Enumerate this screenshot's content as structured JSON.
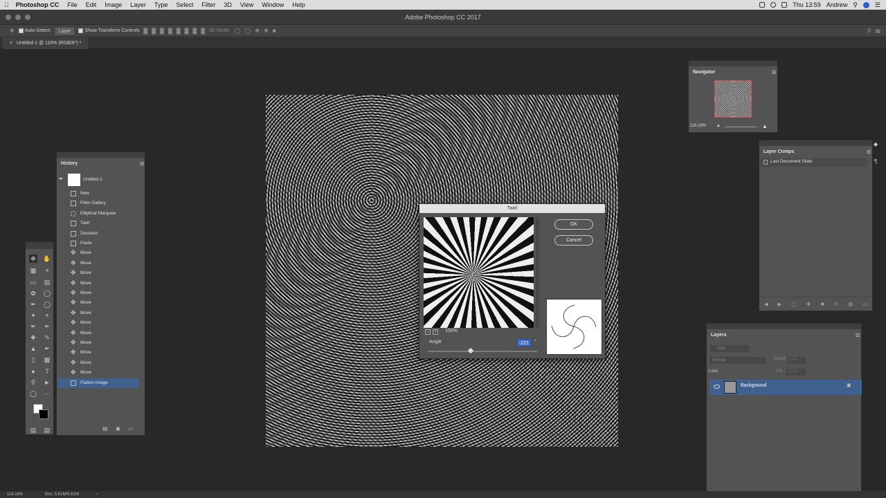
{
  "menubar": {
    "app": "Photoshop CC",
    "items": [
      "File",
      "Edit",
      "Image",
      "Layer",
      "Type",
      "Select",
      "Filter",
      "3D",
      "View",
      "Window",
      "Help"
    ],
    "clock": "Thu 13:59",
    "user": "Andrew"
  },
  "window": {
    "title": "Adobe Photoshop CC 2017"
  },
  "options": {
    "auto_select_label": "Auto-Select:",
    "auto_select_value": "Layer",
    "show_transform_label": "Show Transform Controls",
    "mode_3d_label": "3D Mode:"
  },
  "document_tab": {
    "label": "Untitled-1 @ 116% (RGB/8*) *"
  },
  "history": {
    "title": "History",
    "snapshot": "Untitled-1",
    "items": [
      {
        "label": "New",
        "icon": "doc-icon"
      },
      {
        "label": "Filter Gallery",
        "icon": "doc-icon"
      },
      {
        "label": "Elliptical Marquee",
        "icon": "ellipse-marquee-icon"
      },
      {
        "label": "Twirl",
        "icon": "doc-icon"
      },
      {
        "label": "Deselect",
        "icon": "doc-icon"
      },
      {
        "label": "Paste",
        "icon": "doc-icon"
      },
      {
        "label": "Move",
        "icon": "move-icon"
      },
      {
        "label": "Move",
        "icon": "move-icon"
      },
      {
        "label": "Move",
        "icon": "move-icon"
      },
      {
        "label": "Move",
        "icon": "move-icon"
      },
      {
        "label": "Move",
        "icon": "move-icon"
      },
      {
        "label": "Move",
        "icon": "move-icon"
      },
      {
        "label": "Move",
        "icon": "move-icon"
      },
      {
        "label": "Move",
        "icon": "move-icon"
      },
      {
        "label": "Move",
        "icon": "move-icon"
      },
      {
        "label": "Move",
        "icon": "move-icon"
      },
      {
        "label": "Move",
        "icon": "move-icon"
      },
      {
        "label": "Move",
        "icon": "move-icon"
      },
      {
        "label": "Move",
        "icon": "move-icon"
      },
      {
        "label": "Flatten Image",
        "icon": "doc-icon"
      }
    ],
    "selected_index": 19
  },
  "navigator": {
    "title": "Navigator",
    "zoom": "116.18%"
  },
  "layer_comps": {
    "title": "Layer Comps",
    "state": "Last Document State"
  },
  "layers": {
    "title": "Layers",
    "filter_placeholder": "Kind",
    "blend_mode": "Normal",
    "opacity_label": "Opacity:",
    "opacity_value": "100%",
    "lock_label": "Lock:",
    "fill_label": "Fill:",
    "fill_value": "100%",
    "layer_name": "Background"
  },
  "twirl": {
    "title": "Twirl",
    "ok": "OK",
    "cancel": "Cancel",
    "zoom": "100%",
    "angle_label": "Angle",
    "angle_value": "-221",
    "angle_unit": "°",
    "angle_min": -999,
    "angle_max": 999
  },
  "status": {
    "zoom": "116.18%",
    "doc": "Doc: 5.61M/5.61M"
  },
  "colors": {
    "selection": "#3f6190",
    "accent": "#3d6ecd"
  }
}
